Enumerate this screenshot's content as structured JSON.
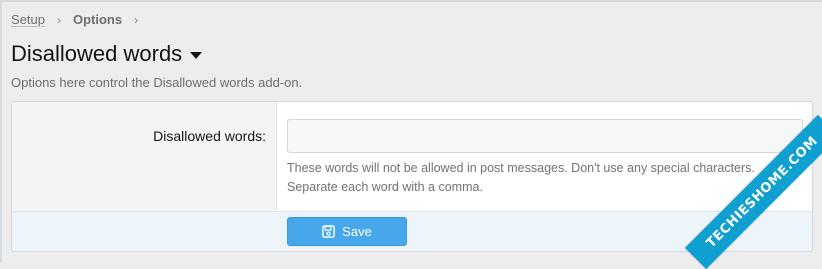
{
  "breadcrumb": {
    "items": [
      "Setup",
      "Options"
    ],
    "separator": "›"
  },
  "header": {
    "title": "Disallowed words",
    "description": "Options here control the Disallowed words add-on."
  },
  "form": {
    "field_label": "Disallowed words:",
    "input_value": "",
    "hint_line1": "These words will not be allowed in post messages. Don't use any special characters.",
    "hint_line2": "Separate each word with a comma."
  },
  "footer": {
    "save_label": "Save",
    "save_icon": "floppy-disk-icon"
  },
  "watermark": {
    "text": "TECHIESHOME.COM"
  },
  "colors": {
    "accent": "#47a7eb",
    "ribbon": "#0f9fd1"
  }
}
